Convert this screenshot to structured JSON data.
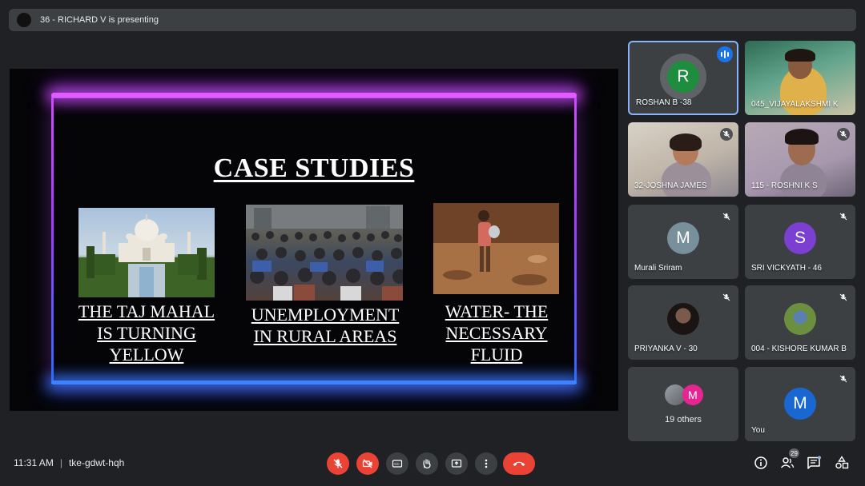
{
  "presenter_bar": {
    "text": "36 - RICHARD V is presenting"
  },
  "slide": {
    "title": "CASE STUDIES",
    "captions": [
      {
        "lines": [
          "THE TAJ MAHAL",
          "IS TURNING",
          "YELLOW"
        ]
      },
      {
        "lines": [
          "UNEMPLOYMENT",
          "IN RURAL AREAS"
        ]
      },
      {
        "lines": [
          "WATER- THE",
          "NECESSARY",
          "FLUID"
        ]
      }
    ]
  },
  "participants": [
    {
      "name": "ROSHAN B -38",
      "type": "avatar",
      "initial": "R",
      "avatar_color": "#1e8e3e",
      "speaking": true
    },
    {
      "name": "045_VIJAYALAKSHMI K",
      "type": "video"
    },
    {
      "name": "32-JOSHNA JAMES",
      "type": "video",
      "muted": true
    },
    {
      "name": "115 - ROSHNI K S",
      "type": "video",
      "muted": true
    },
    {
      "name": "Murali Sriram",
      "type": "avatar",
      "initial": "M",
      "avatar_color": "#78909c",
      "muted": true
    },
    {
      "name": "SRI VICKYATH - 46",
      "type": "avatar",
      "initial": "S",
      "avatar_color": "#7b3fd1",
      "muted": true
    },
    {
      "name": "PRIYANKA V - 30",
      "type": "photo-avatar",
      "muted": true
    },
    {
      "name": "004 - KISHORE KUMAR B",
      "type": "photo-avatar",
      "muted": true
    },
    {
      "name": "You",
      "type": "avatar",
      "initial": "M",
      "avatar_color": "#1967d2",
      "muted": true
    }
  ],
  "others_tile": {
    "label": "19 others",
    "initial": "M"
  },
  "meeting": {
    "time": "11:31 AM",
    "separator": "|",
    "code": "tke-gdwt-hqh"
  },
  "side_buttons": {
    "people_count": "29"
  },
  "colors": {
    "background": "#202124",
    "tile": "#3c4043",
    "danger": "#ea4335",
    "active_border": "#8ab4f8"
  },
  "icons": [
    "mic-off-icon",
    "camera-off-icon",
    "captions-icon",
    "raise-hand-icon",
    "present-icon",
    "more-options-icon",
    "end-call-icon",
    "info-icon",
    "people-icon",
    "chat-icon",
    "activities-icon"
  ]
}
